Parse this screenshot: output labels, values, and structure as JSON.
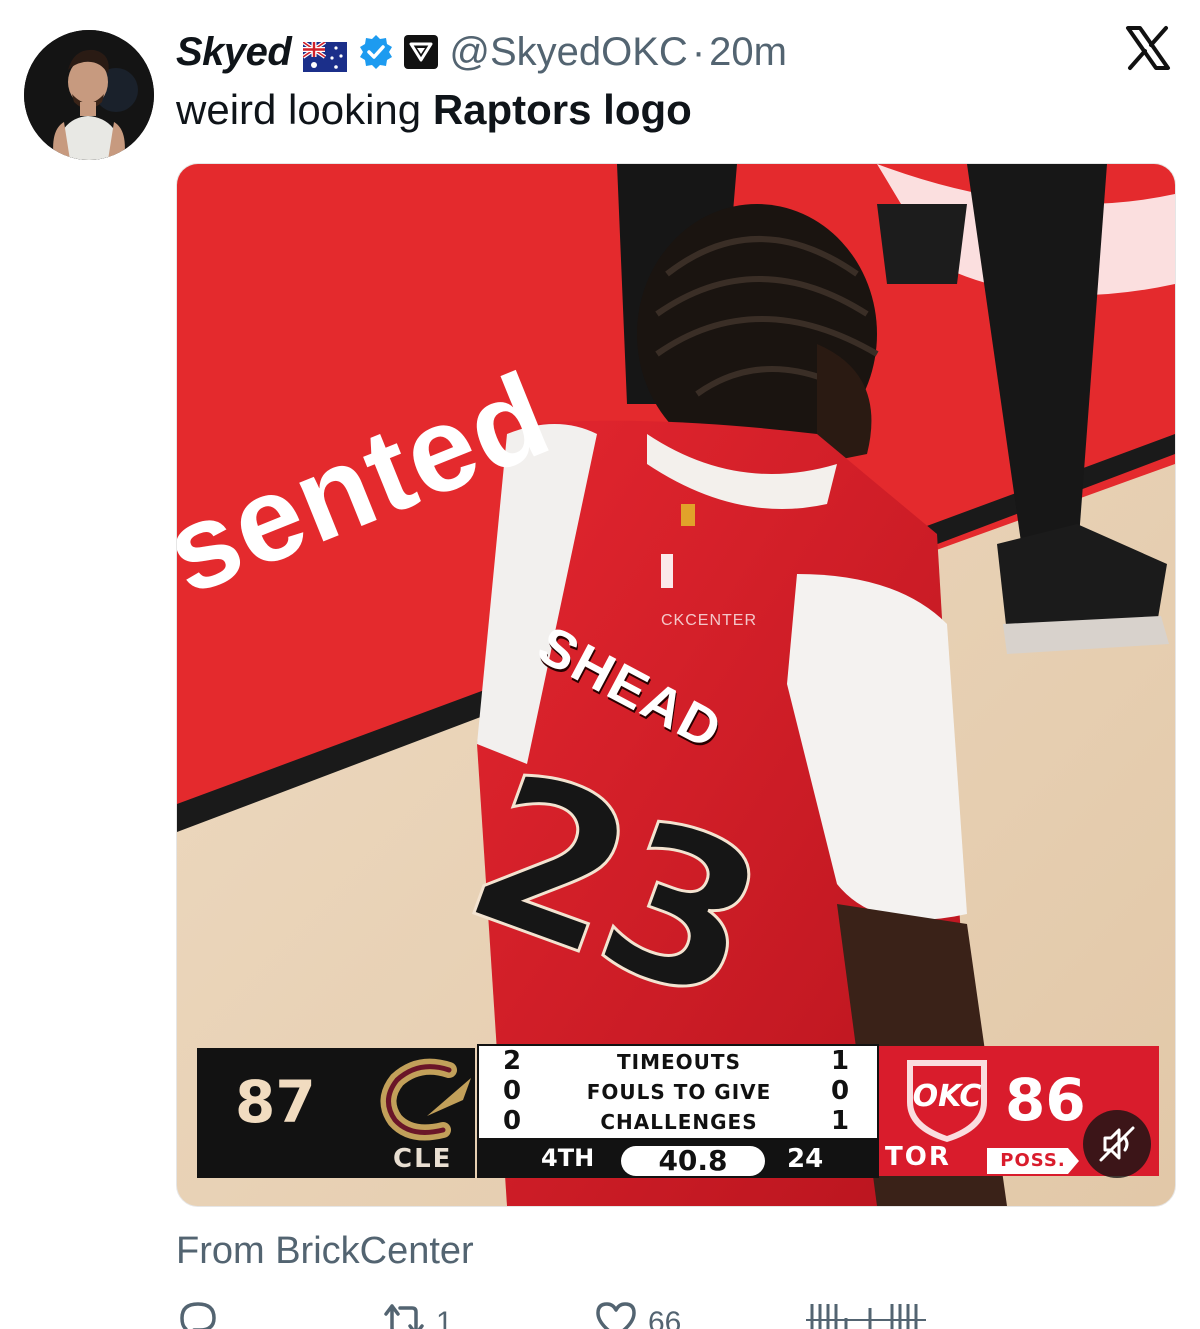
{
  "post": {
    "author_name": "Skyed",
    "handle": "@SkyedOKC",
    "separator": "·",
    "time": "20m",
    "text_prefix": "weird looking ",
    "text_bold": "Raptors logo",
    "source": "From BrickCenter"
  },
  "media": {
    "court_text": "sented",
    "jersey_name": "SHEAD",
    "jersey_number": "23",
    "watermark": "CKCENTER"
  },
  "scoreboard": {
    "home_score": "87",
    "home_abbr": "CLE",
    "away_score": "86",
    "away_abbr": "TOR",
    "rows": [
      {
        "left": "2",
        "label": "TIMEOUTS",
        "right": "1"
      },
      {
        "left": "0",
        "label": "FOULS TO GIVE",
        "right": "0"
      },
      {
        "left": "0",
        "label": "CHALLENGES",
        "right": "1"
      }
    ],
    "quarter": "4TH",
    "clock": "40.8",
    "shot_clock": "24",
    "possession": "POSS.",
    "away_logo_text": "OKC"
  },
  "actions": {
    "retweets": "1",
    "likes": "66"
  },
  "icons": {
    "flag": "australia-flag-icon",
    "verified": "verified-badge-icon",
    "affiliate": "affiliate-badge-icon",
    "platform": "x-logo-icon",
    "mute": "mute-icon",
    "reply": "reply-icon",
    "retweet": "retweet-icon",
    "like": "heart-icon",
    "views": "views-icon"
  },
  "colors": {
    "verified_blue": "#1d9bf0",
    "text_secondary": "#536471",
    "raptors_red": "#d91c2c",
    "cavs_gold": "#f1dcc0"
  }
}
